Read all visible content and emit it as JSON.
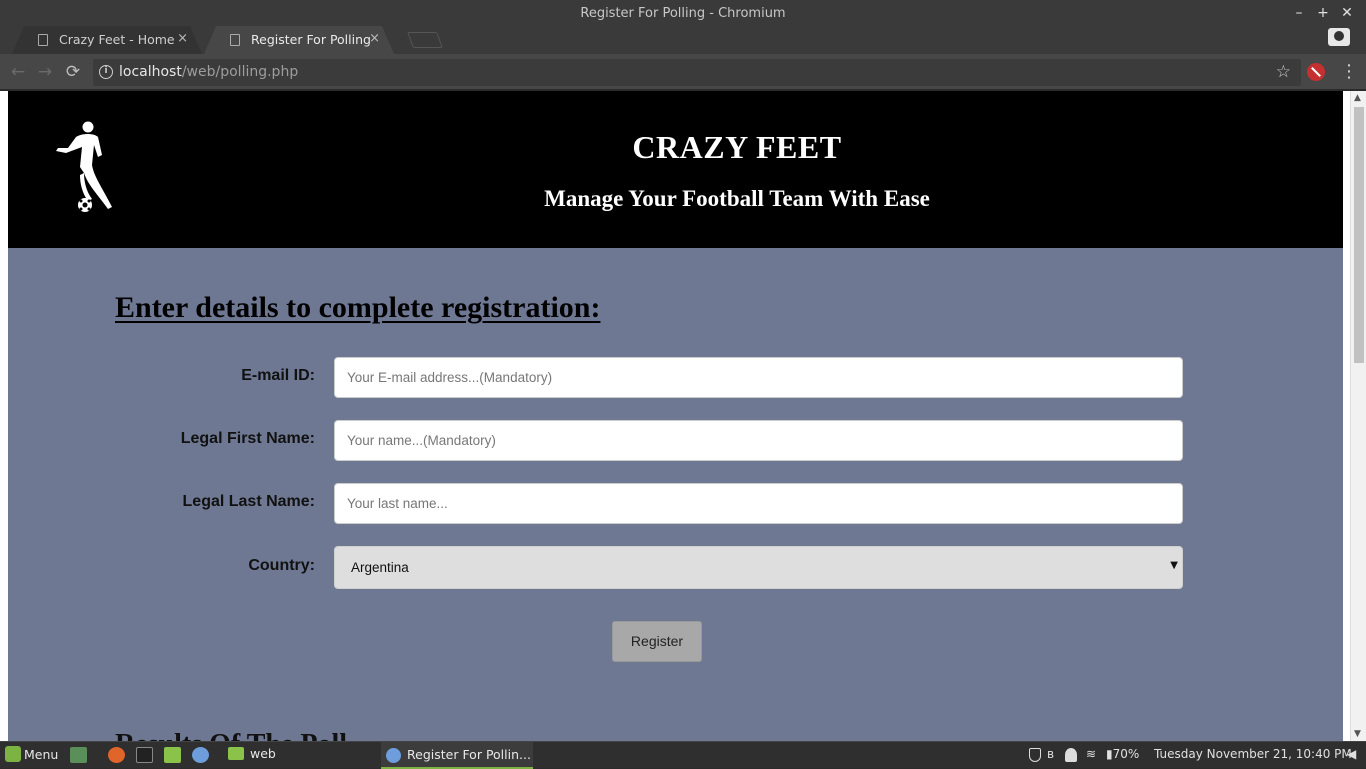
{
  "window": {
    "title": "Register For Polling - Chromium",
    "controls": {
      "minimize": "–",
      "maximize": "+",
      "close": "✕"
    }
  },
  "tabs": [
    {
      "label": "Crazy Feet - Home",
      "icon": "page-icon",
      "close": "×"
    },
    {
      "label": "Register For Polling",
      "icon": "page-icon",
      "close": "×"
    }
  ],
  "toolbar": {
    "back": "←",
    "forward": "→",
    "reload": "⟳",
    "url_host": "localhost",
    "url_path": "/web/polling.php",
    "star": "☆",
    "menu": "⋮"
  },
  "site": {
    "title": "CRAZY FEET",
    "subtitle": "Manage Your Football Team With Ease",
    "logo_icon": "football-player-icon"
  },
  "form": {
    "heading": "Enter details to complete registration:",
    "email": {
      "label": "E-mail ID:",
      "placeholder": "Your E-mail address...(Mandatory)",
      "value": ""
    },
    "first_name": {
      "label": "Legal First Name:",
      "placeholder": "Your name...(Mandatory)",
      "value": ""
    },
    "last_name": {
      "label": "Legal Last Name:",
      "placeholder": "Your last name...",
      "value": ""
    },
    "country": {
      "label": "Country:",
      "selected": "Argentina",
      "arrow": "▼"
    },
    "submit_label": "Register"
  },
  "results": {
    "heading": "Results Of The Poll"
  },
  "taskbar": {
    "menu_label": "Menu",
    "web_label": "web",
    "active_task": "Register For Pollin...",
    "battery": "70%",
    "clock": "Tuesday November 21, 10:40 PM"
  }
}
